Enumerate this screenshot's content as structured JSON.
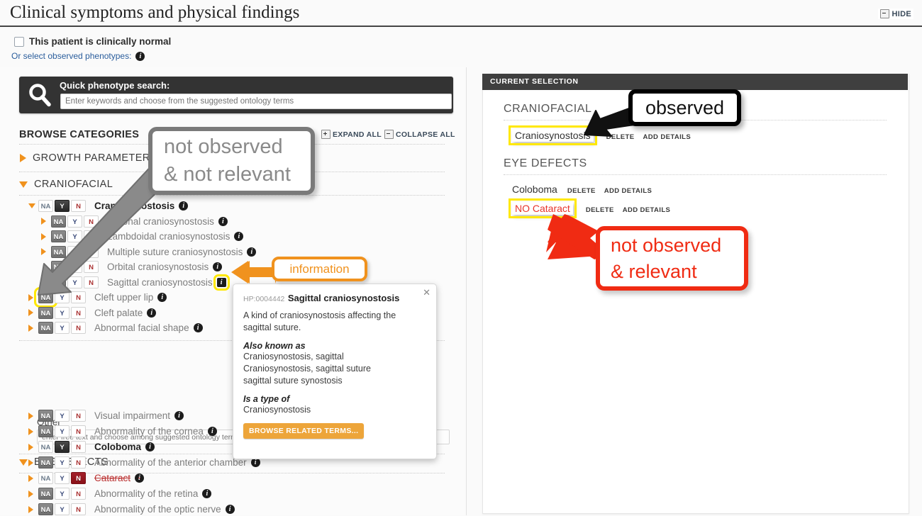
{
  "header": {
    "title": "Clinical symptoms and physical findings",
    "hide_label": "HIDE",
    "hide_icon": "minus-box-icon"
  },
  "top_controls": {
    "clinically_normal_label": "This patient is clinically normal",
    "clinically_normal_checked": false,
    "observed_phenotypes_label": "Or select observed phenotypes:",
    "help_icon": "info-icon"
  },
  "search": {
    "icon": "magnifier-icon",
    "label": "Quick phenotype search:",
    "placeholder": "Enter keywords and choose from the suggested ontology terms",
    "value": ""
  },
  "browse": {
    "title": "BROWSE CATEGORIES",
    "expand_all_label": "EXPAND ALL",
    "collapse_all_label": "COLLAPSE ALL",
    "expand_icon": "plus-box-icon",
    "collapse_icon": "minus-box-icon",
    "categories": [
      {
        "label": "GROWTH PARAMETERS",
        "expanded": false
      },
      {
        "label": "CRANIOFACIAL",
        "expanded": true
      },
      {
        "label": "EYE DEFECTS",
        "expanded": true
      }
    ]
  },
  "craniofacial_terms": [
    {
      "label": "Craniosynostosis",
      "indent": 0,
      "arrow": "down",
      "state": "Y",
      "style": "selected"
    },
    {
      "label": "Coronal craniosynostosis",
      "indent": 1,
      "arrow": "right",
      "state": "NA",
      "style": "normal"
    },
    {
      "label": "Lambdoidal craniosynostosis",
      "indent": 1,
      "arrow": "right",
      "state": "NA",
      "style": "normal"
    },
    {
      "label": "Multiple suture craniosynostosis",
      "indent": 1,
      "arrow": "right",
      "state": "NA",
      "style": "normal"
    },
    {
      "label": "Orbital craniosynostosis",
      "indent": 1,
      "arrow": "none",
      "state": "NA",
      "style": "normal"
    },
    {
      "label": "Sagittal craniosynostosis",
      "indent": 1,
      "arrow": "none",
      "state": "NA",
      "style": "normal"
    },
    {
      "label": "Cleft upper lip",
      "indent": 0,
      "arrow": "right",
      "state": "NA",
      "style": "normal"
    },
    {
      "label": "Cleft palate",
      "indent": 0,
      "arrow": "right",
      "state": "NA",
      "style": "normal"
    },
    {
      "label": "Abnormal facial shape",
      "indent": 0,
      "arrow": "right",
      "state": "NA",
      "style": "normal"
    }
  ],
  "eye_terms": [
    {
      "label": "Visual impairment",
      "indent": 0,
      "arrow": "right",
      "state": "NA",
      "style": "normal"
    },
    {
      "label": "Abnormality of the cornea",
      "indent": 0,
      "arrow": "right",
      "state": "NA",
      "style": "normal"
    },
    {
      "label": "Coloboma",
      "indent": 0,
      "arrow": "right",
      "state": "Y",
      "style": "selected"
    },
    {
      "label": "Abnormality of the anterior chamber",
      "indent": 0,
      "arrow": "right",
      "state": "NA",
      "style": "normal"
    },
    {
      "label": "Cataract",
      "indent": 0,
      "arrow": "right",
      "state": "N",
      "style": "negated"
    },
    {
      "label": "Abnormality of the retina",
      "indent": 0,
      "arrow": "right",
      "state": "NA",
      "style": "normal"
    },
    {
      "label": "Abnormality of the optic nerve",
      "indent": 0,
      "arrow": "right",
      "state": "NA",
      "style": "normal"
    }
  ],
  "toggle_labels": {
    "na": "NA",
    "y": "Y",
    "n": "N"
  },
  "other": {
    "label": "Other",
    "placeholder": "enter free text and choose among suggested ontology terms",
    "value": ""
  },
  "popover": {
    "id": "HP:0004442",
    "title": "Sagittal craniosynostosis",
    "definition": "A kind of craniosynostosis affecting the sagittal suture.",
    "also_known_as_heading": "Also known as",
    "synonyms": [
      "Craniosynostosis, sagittal",
      "Craniosynostosis, sagittal suture",
      "sagittal suture synostosis"
    ],
    "is_a_type_of_heading": "Is a type of",
    "parents": [
      "Craniosynostosis"
    ],
    "browse_related_label": "BROWSE RELATED TERMS...",
    "close_icon": "close-icon"
  },
  "current_selection": {
    "header": "CURRENT SELECTION",
    "groups": [
      {
        "name": "CRANIOFACIAL",
        "items": [
          {
            "name": "Craniosynostosis",
            "negated": false,
            "highlighted": true,
            "delete_label": "DELETE",
            "add_details_label": "ADD DETAILS"
          }
        ]
      },
      {
        "name": "EYE DEFECTS",
        "items": [
          {
            "name": "Coloboma",
            "negated": false,
            "highlighted": false,
            "delete_label": "DELETE",
            "add_details_label": "ADD DETAILS"
          },
          {
            "name": "NO Cataract",
            "negated": true,
            "highlighted": true,
            "delete_label": "DELETE",
            "add_details_label": "ADD DETAILS"
          }
        ]
      }
    ]
  },
  "annotations": [
    {
      "id": "not-observed-not-relevant",
      "text_lines": [
        "not observed",
        "& not relevant"
      ],
      "color": "#8a8a8a",
      "border": "#7a7a7a"
    },
    {
      "id": "information",
      "text_lines": [
        "information"
      ],
      "color": "#f0921e",
      "border": "#f0921e"
    },
    {
      "id": "observed",
      "text_lines": [
        "observed"
      ],
      "color": "#111111",
      "border": "#000000"
    },
    {
      "id": "not-observed-relevant",
      "text_lines": [
        "not observed",
        "& relevant"
      ],
      "color": "#f02b13",
      "border": "#f02b13"
    }
  ],
  "colors": {
    "accent_orange": "#f0921e",
    "negated_red": "#e8332a",
    "highlight_yellow": "#ffe800",
    "dark_panel": "#333333"
  }
}
